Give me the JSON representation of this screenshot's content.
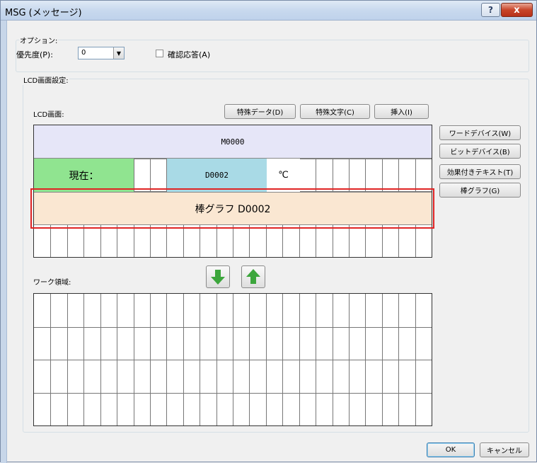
{
  "window": {
    "title": "MSG (メッセージ)",
    "help_label": "?",
    "close_label": "x"
  },
  "options": {
    "group_label": "オプション:",
    "priority_label": "優先度(P):",
    "priority_value": "0",
    "confirm_label": "確認応答(A)",
    "confirm_checked": false
  },
  "lcd_settings": {
    "group_label": "LCD画面設定:",
    "screen_label": "LCD画面:",
    "buttons": {
      "special_data": "特殊データ(D)",
      "special_char": "特殊文字(C)",
      "insert": "挿入(I)"
    },
    "side_buttons": {
      "word_device": "ワードデバイス(W)",
      "bit_device": "ビットデバイス(B)",
      "effect_text": "効果付きテキスト(T)",
      "bar_graph": "棒グラフ(G)"
    },
    "lcd_rows": {
      "row1_text": "M0000",
      "row2_current": "現在：",
      "row2_device": "D0002",
      "row2_unit": "℃",
      "row3_text": "棒グラフ D0002"
    },
    "colors": {
      "row1_bg": "#e6e6f8",
      "current_bg": "#90e490",
      "device_bg": "#a9dae6",
      "bar_bg": "#fae7d2",
      "highlight": "#e02424"
    },
    "work_label": "ワーク領域:",
    "down_icon": "arrow-down-icon",
    "up_icon": "arrow-up-icon"
  },
  "footer": {
    "ok_label": "OK",
    "cancel_label": "キャンセル"
  }
}
